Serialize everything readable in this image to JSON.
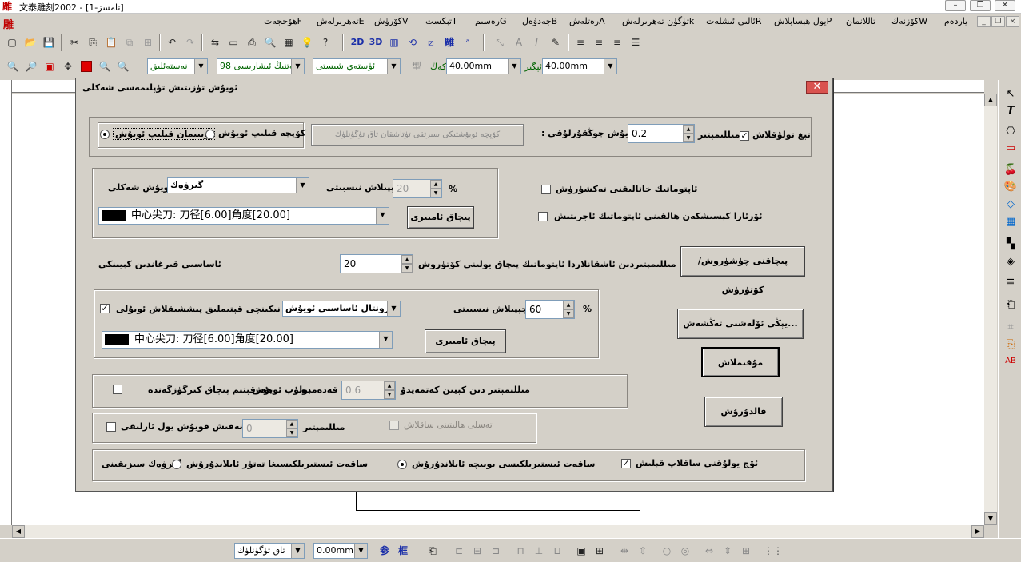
{
  "app": {
    "title": "文泰雕刻2002 - [تامسز-1]",
    "logo": "雕",
    "window_buttons": {
      "minimize": "–",
      "restore": "❐",
      "close": "✕"
    }
  },
  "menu": {
    "items": [
      "ياردەم",
      "كۆزنەكW",
      "تاللانمان",
      "يول ھېسابلاشP",
      "ئالىي ئىشلەتR",
      "تۈگۈن تەھرىرلەشk",
      "رەتلەشA",
      "جەدۋەلB",
      "رەسىمG",
      "تېكستT",
      "كۆرۈشV",
      "تەھرىرلەشE",
      "ھۆججەتF"
    ],
    "logo": "雕",
    "mdi": {
      "minimize": "_",
      "restore": "❐",
      "close": "×"
    }
  },
  "toolbar1": {
    "icons": [
      "new",
      "open",
      "save",
      "cut",
      "copy",
      "paste-disabled",
      "clone-disabled",
      "undo",
      "redo-disabled",
      "arrange",
      "text-tool",
      "print",
      "preview",
      "bitmap",
      "lamp",
      "help",
      "2D",
      "3D",
      "column-text",
      "rotate",
      "shear",
      "diao",
      "letter-tool",
      "measure",
      "frame",
      "italic",
      "edit-text",
      "align-right",
      "align-center",
      "align-left",
      "align-justify"
    ]
  },
  "toolbar2": {
    "zoom_icons": [
      "zoom-in",
      "zoom-out",
      "zoom-box",
      "pan",
      "color-red",
      "zoom-tool",
      "zoom-page"
    ],
    "font_style": "نەستەئلىق",
    "font_name": "ئالەتنىڭ ئىشارىسى 98",
    "font_style2": "ئۈستەي شىستى",
    "width_label": "كەڭ",
    "width_value": "40.00mm",
    "height_label": "ئېگىز",
    "height_value": "40.00mm"
  },
  "dialog": {
    "title": "ئويۇش تۈزىتىش تۈپلىمەسى شەكلى",
    "close": "✕",
    "row1": {
      "depth_label": "ئويۇش چوڭقۇرلۇقى :",
      "depth_value": "0.2",
      "unit": "مىللىمېتىر",
      "clear_label": "تېغ تولۇقلاش",
      "clear_checked": "✓",
      "path_btn": "كۆپچە ئويۇشتىكى سىرتقى تۈتاشقان تاق تۈگۈنلۈك",
      "radio_multi": "كۆپچە قىلىپ ئويۇش",
      "radio_plain": "ئويىيمان قىلىپ ئويۇش"
    },
    "shape": {
      "shape_label": "ئويۇش شەكلى",
      "shape_value": "گىرۋەك",
      "overlap_label": "چېپىلاش نىسبىتى",
      "overlap_value": "20",
      "overlap_unit": "%",
      "tool_value": "中心尖刀: 刀径[6.00]角度[20.00]",
      "knife_btn": "پىچاق ئامبىرى"
    },
    "auto1": "ئاپتوماتىك خاتالىقنى تەكشۈرۈش",
    "auto2": "ئۆزئارا كېسىشكەن ھالقىنى ئاپتوماتىك ئاجرىتىش",
    "spacing": {
      "label": "مىللىمېتىردىن ئاشقانلاردا ئاپتوماتىك پىچاق يولىنى كۆتۈرۈش",
      "value": "20",
      "suffix": "ئاساسىي قىرغاندىن كېيىنكى"
    },
    "knife_plan_btn": "پىچاقنى چۈشۈرۈش/كۆتۈرۈش",
    "fill": {
      "checked": "✓",
      "label": "نىكىنچى قېتىملىق پىششىقلاش ئويۇلى",
      "direction": "گورىزونتال ئاساسىي ئويۇش",
      "overlap_label": "چېپىلاش نىسبىتى",
      "overlap_value": "60",
      "overlap_unit": "%",
      "tool_value": "中心尖刀: 刀径[6.00]角度[20.00]",
      "knife_btn": "پىچاق ئامبىرى"
    },
    "advanced_btn": "يېڭى ئۆلەشنى تەڭشەش...",
    "ok_btn": "مۇقىملاش",
    "cancel_btn": "قالدۇرۇش",
    "edge": {
      "label": "مىللىمېتىر دىن كېيىن كەتمەيدىغان قەدەمدە بولۇپ ئويۇش ھەرقېتىم پىچاق كىرگۈزگەندە",
      "value": "0.6"
    },
    "trace": {
      "label": "نەقىش قويۇش يول ئارلىقى",
      "value": "0",
      "unit": "مىللىمېتىر",
      "disabled_label": "تەسلى ھالىتىنى ساقلاش"
    },
    "order": {
      "label1": "ئۆچ يولۇقنى ساقلاپ قېلىش",
      "checked": "✓",
      "label2": "ساقەت ئىستىرىلكىسى بويىچە ئايلاندۇرۇش",
      "label3": "ساقەت ئىستىرىلكىسىغا تەتۈر ئايلاندۇرۇش",
      "label4": "گىرۋەك سىزىقىنى"
    }
  },
  "statusbar": {
    "combo1": "تاق تۈگۈنلۈك",
    "combo2": "0.00mm",
    "icons": [
      "shen",
      "kuang"
    ]
  }
}
